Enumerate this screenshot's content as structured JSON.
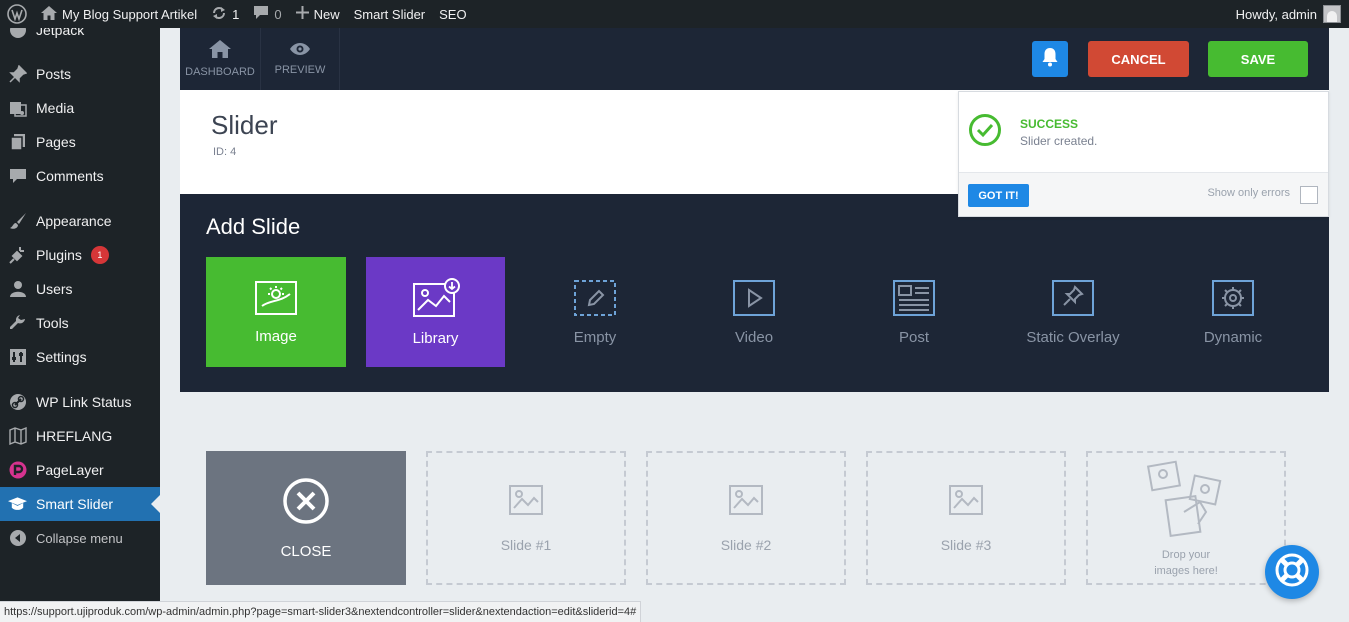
{
  "adminbar": {
    "site_name": "My Blog Support Artikel",
    "updates_count": "1",
    "comments_count": "0",
    "new_label": "New",
    "smart_slider": "Smart Slider",
    "seo": "SEO",
    "howdy": "Howdy, admin"
  },
  "sidebar": {
    "items": [
      {
        "label": "Jetpack",
        "icon": "jetpack-icon"
      },
      {
        "label": "Posts",
        "icon": "pin-icon"
      },
      {
        "label": "Media",
        "icon": "media-icon"
      },
      {
        "label": "Pages",
        "icon": "pages-icon"
      },
      {
        "label": "Comments",
        "icon": "comment-icon"
      },
      {
        "label": "Appearance",
        "icon": "brush-icon"
      },
      {
        "label": "Plugins",
        "icon": "plug-icon",
        "badge": "1"
      },
      {
        "label": "Users",
        "icon": "user-icon"
      },
      {
        "label": "Tools",
        "icon": "wrench-icon"
      },
      {
        "label": "Settings",
        "icon": "settings-icon"
      },
      {
        "label": "WP Link Status",
        "icon": "link-icon"
      },
      {
        "label": "HREFLANG",
        "icon": "map-icon"
      },
      {
        "label": "PageLayer",
        "icon": "pagelayer-icon"
      },
      {
        "label": "Smart Slider",
        "icon": "mortarboard-icon"
      },
      {
        "label": "Collapse menu",
        "icon": "collapse-icon"
      }
    ]
  },
  "toolbar": {
    "dashboard": "DASHBOARD",
    "preview": "PREVIEW",
    "cancel": "CANCEL",
    "save": "SAVE"
  },
  "slider": {
    "title": "Slider",
    "id_label": "ID: 4"
  },
  "add_slide": {
    "heading": "Add Slide",
    "tiles": [
      "Image",
      "Library",
      "Empty",
      "Video",
      "Post",
      "Static Overlay",
      "Dynamic"
    ]
  },
  "slides": {
    "close": "CLOSE",
    "items": [
      "Slide #1",
      "Slide #2",
      "Slide #3"
    ],
    "drop_line1": "Drop your",
    "drop_line2": "images here!"
  },
  "notification": {
    "title": "SUCCESS",
    "message": "Slider created.",
    "got_it": "GOT IT!",
    "show_only_errors": "Show only errors"
  },
  "statusbar": {
    "url": "https://support.ujiproduk.com/wp-admin/admin.php?page=smart-slider3&nextendcontroller=slider&nextendaction=edit&sliderid=4#"
  }
}
